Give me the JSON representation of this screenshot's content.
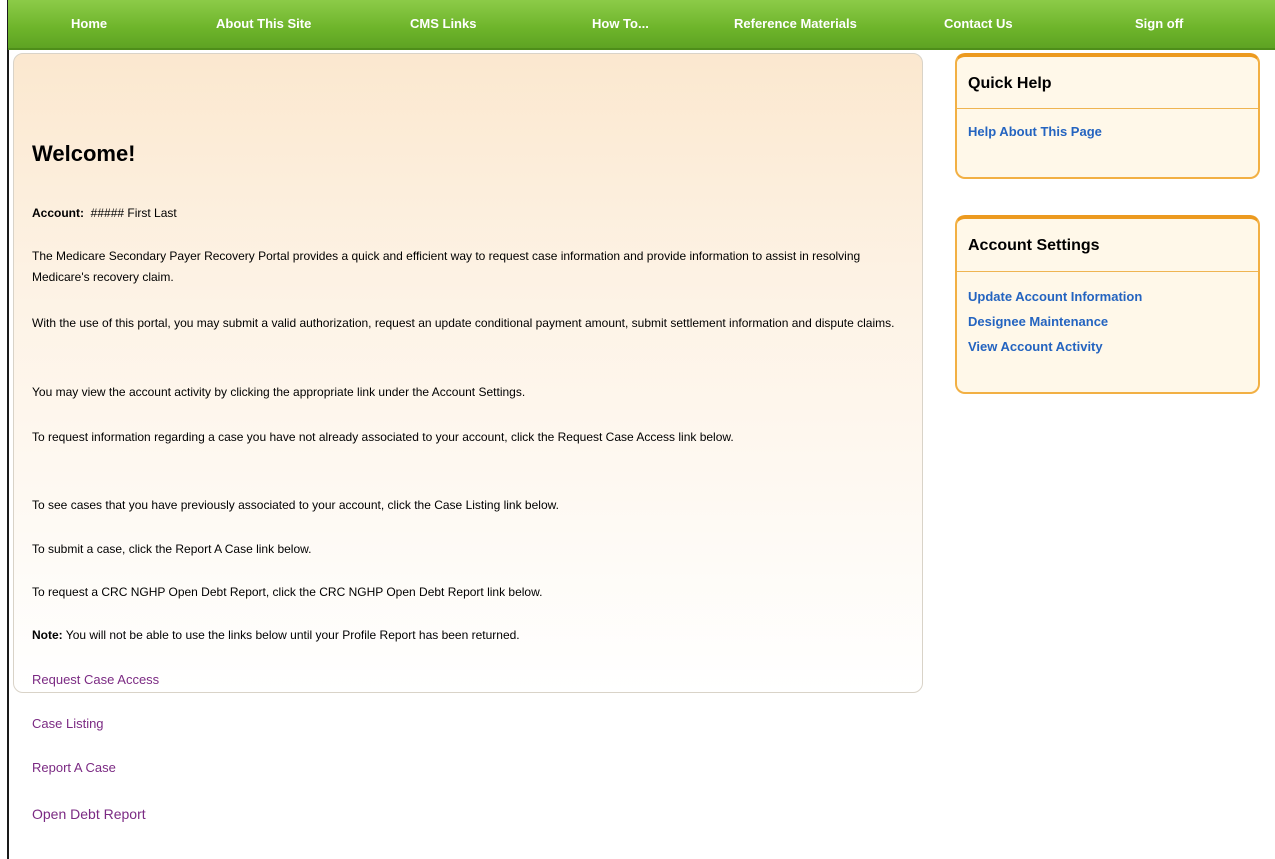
{
  "nav": {
    "items": [
      {
        "label": "Home"
      },
      {
        "label": "About This Site"
      },
      {
        "label": "CMS Links"
      },
      {
        "label": "How To..."
      },
      {
        "label": "Reference Materials"
      },
      {
        "label": "Contact Us"
      },
      {
        "label": "Sign off"
      }
    ]
  },
  "main": {
    "title": "Welcome!",
    "account_label": "Account:",
    "account_value": "##### First Last",
    "paragraphs": [
      "The Medicare Secondary Payer Recovery Portal provides a quick and efficient way to request case information and provide information to assist in resolving Medicare's recovery claim.",
      "With the use of this portal, you may submit a valid authorization, request an update conditional payment amount, submit settlement information and dispute claims.",
      "You may view the account activity by clicking the appropriate link under the Account Settings.",
      "To request information regarding a case you have not already associated to your account, click the Request Case Access link below.",
      "To see cases that you have previously associated to your account, click the Case Listing link below.",
      "To submit a case, click the Report A Case link below.",
      "To request a CRC NGHP Open Debt Report, click the CRC NGHP Open Debt Report link below."
    ],
    "note_label": "Note:",
    "note_text": "You will not be able to use the links below until your Profile Report has been returned.",
    "links": [
      {
        "label": "Request Case Access"
      },
      {
        "label": "Case Listing"
      },
      {
        "label": "Report A Case"
      },
      {
        "label": "Open Debt Report"
      }
    ]
  },
  "quick_help": {
    "title": "Quick Help",
    "links": [
      {
        "label": "Help About This Page"
      }
    ]
  },
  "account_settings": {
    "title": "Account Settings",
    "links": [
      {
        "label": "Update Account Information"
      },
      {
        "label": "Designee Maintenance"
      },
      {
        "label": "View Account Activity"
      }
    ]
  },
  "colors": {
    "nav_green": "#6db42a",
    "link_purple": "#7b2a83",
    "link_blue": "#2464c0",
    "box_orange": "#ec9a1f"
  }
}
